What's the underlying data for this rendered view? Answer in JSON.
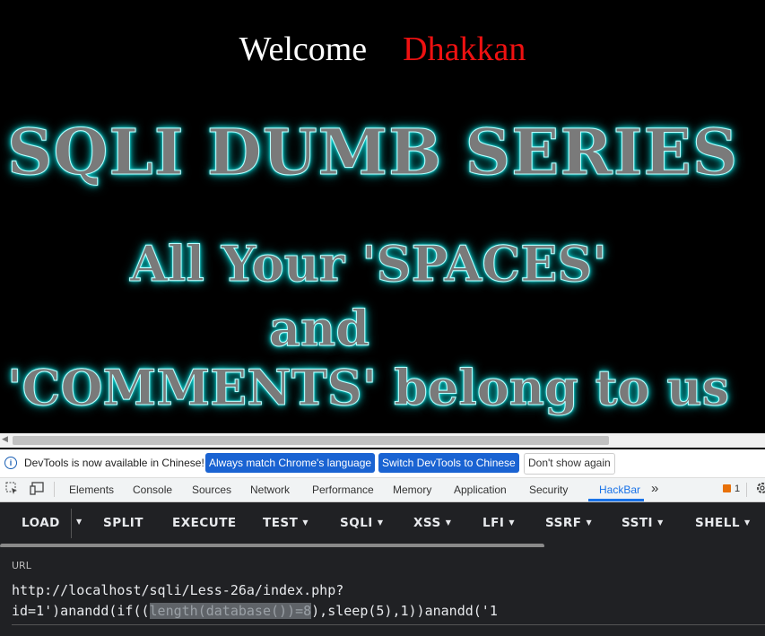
{
  "page": {
    "welcome_label": "Welcome",
    "user_name": "Dhakkan",
    "banner_line1": "SQLI DUMB SERIES",
    "banner_line2": "All Your 'SPACES'",
    "banner_line3": "and",
    "banner_line4": "'COMMENTS' belong to us"
  },
  "infobar": {
    "message": "DevTools is now available in Chinese!",
    "btn_match": "Always match Chrome's language",
    "btn_switch": "Switch DevTools to Chinese",
    "btn_dismiss": "Don't show again"
  },
  "devtools": {
    "tabs": [
      "Elements",
      "Console",
      "Sources",
      "Network",
      "Performance",
      "Memory",
      "Application",
      "Security",
      "HackBar"
    ],
    "more": "»",
    "issues_count": "1"
  },
  "hackbar": {
    "load": "LOAD",
    "split": "SPLIT",
    "execute": "EXECUTE",
    "test": "TEST",
    "sqli": "SQLI",
    "xss": "XSS",
    "lfi": "LFI",
    "ssrf": "SSRF",
    "ssti": "SSTI",
    "shell": "SHELL"
  },
  "url": {
    "label": "URL",
    "line1": "http://localhost/sqli/Less-26a/index.php?",
    "line2_before": "id=1')anandd(if((",
    "line2_selected": "length(database())=8",
    "line2_after": "),sleep(5),1))anandd('1"
  },
  "colors": {
    "welcome": "#ffffff",
    "user_name": "#ee1111",
    "banner_glow": "#00cccc",
    "hackbar_bg": "#202124",
    "primary_button": "#1a63d2"
  }
}
